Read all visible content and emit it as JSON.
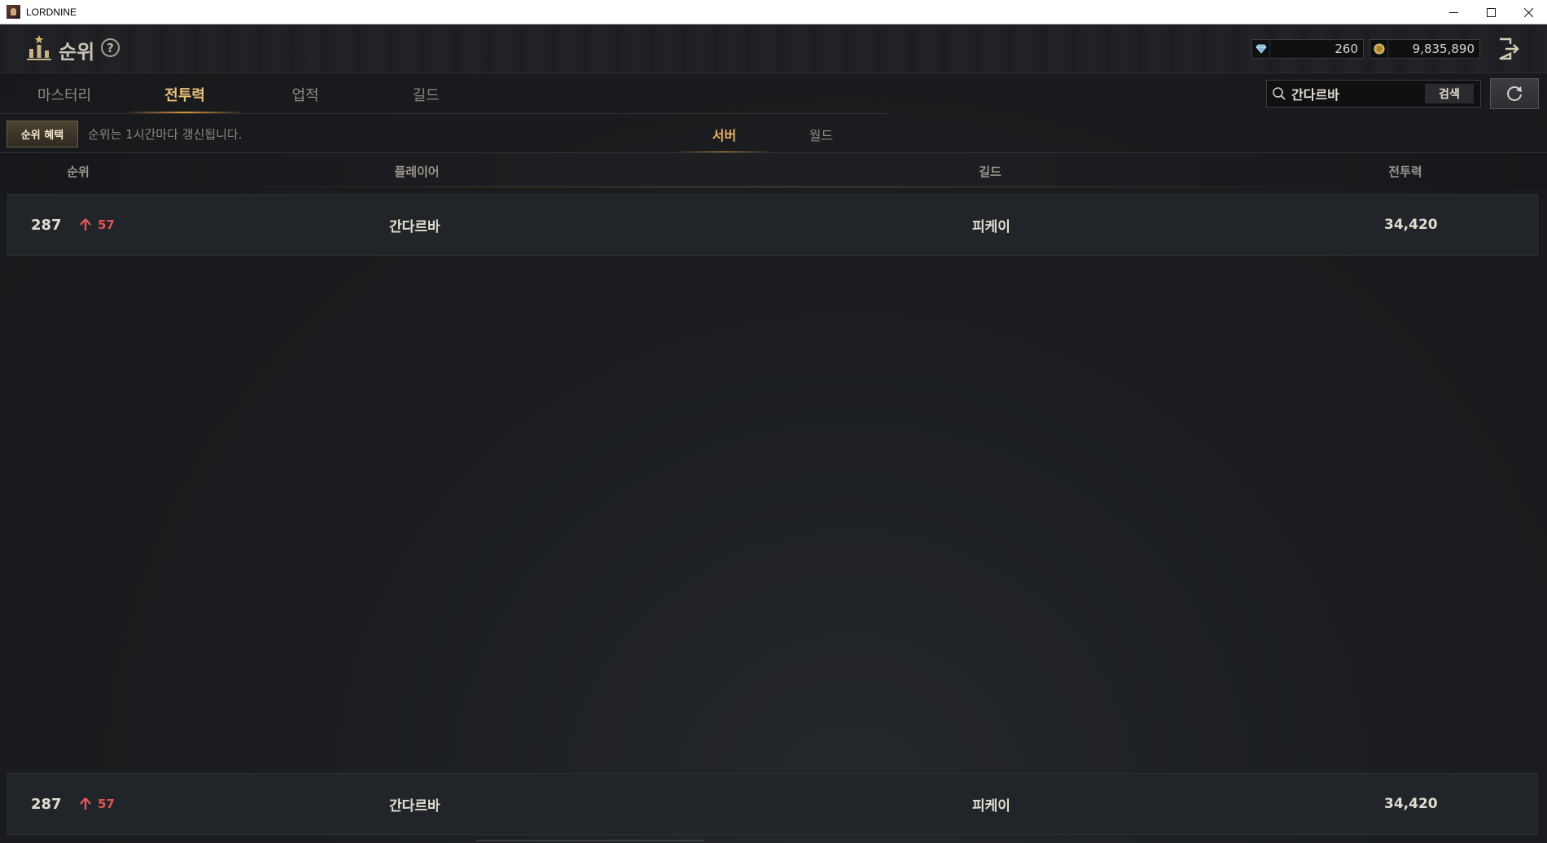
{
  "window": {
    "title": "LORDNINE"
  },
  "header": {
    "title": "순위",
    "currency": {
      "gem": "260",
      "gold": "9,835,890"
    }
  },
  "tabs": [
    "마스터리",
    "전투력",
    "업적",
    "길드"
  ],
  "active_tab": 1,
  "search": {
    "value": "간다르바",
    "button_label": "검색"
  },
  "benefit_button": "순위 혜택",
  "update_notice": "순위는 1시간마다 갱신됩니다.",
  "sub_tabs": [
    "서버",
    "월드"
  ],
  "active_sub_tab": 0,
  "table": {
    "headers": [
      "순위",
      "플레이어",
      "길드",
      "전투력"
    ],
    "rows": [
      {
        "rank": "287",
        "change": "57",
        "player": "간다르바",
        "guild": "피케이",
        "power": "34,420"
      }
    ]
  },
  "my_rank": {
    "rank": "287",
    "change": "57",
    "player": "간다르바",
    "guild": "피케이",
    "power": "34,420"
  },
  "colors": {
    "accent": "#d9963a",
    "rank_up": "#e05555",
    "background": "#1b1d20"
  }
}
